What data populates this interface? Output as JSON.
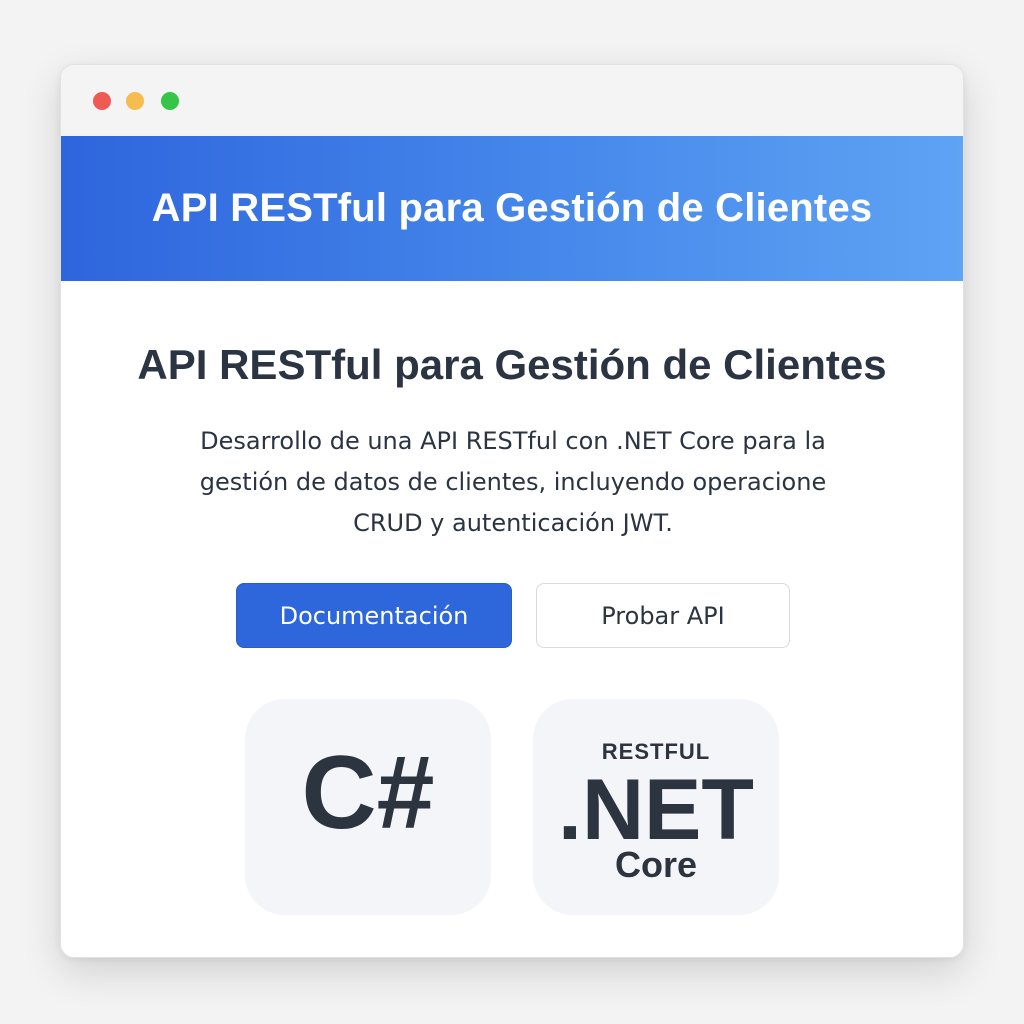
{
  "window": {
    "controls": [
      {
        "name": "close",
        "color": "#f05a55"
      },
      {
        "name": "minimize",
        "color": "#f5bd4f"
      },
      {
        "name": "maximize",
        "color": "#35c548"
      }
    ]
  },
  "banner": {
    "title": "API RESTful para Gestión de Clientes",
    "gradient_start": "#2e65dd",
    "gradient_end": "#5ea3f4"
  },
  "main": {
    "heading": "API RESTful para Gestión de Clientes",
    "description_lines": [
      "Desarrollo de una API RESTful con .NET Core para la",
      "gestión de datos de clientes, incluyendo operacione",
      "CRUD y autenticación JWT."
    ],
    "buttons": {
      "primary_label": "Documentación",
      "secondary_label": "Probar API",
      "accent": "#2e66db"
    }
  },
  "tiles": {
    "csharp": {
      "label": "C#",
      "icon": "csharp-logo-icon"
    },
    "dotnet": {
      "top": "RESTFUL",
      "main": ".NET",
      "bottom": "Core",
      "icon": "dotnet-core-logo-icon"
    }
  }
}
